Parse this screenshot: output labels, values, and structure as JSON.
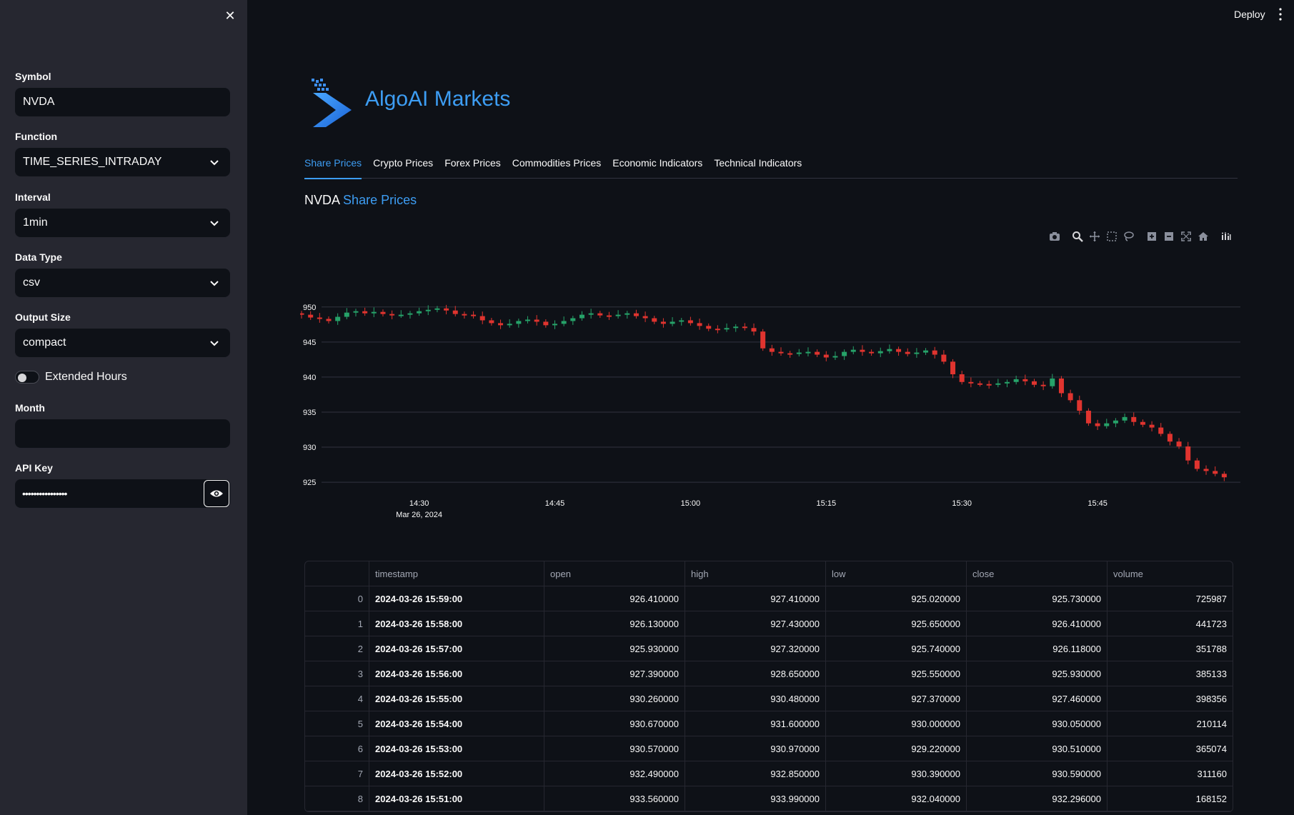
{
  "sidebar": {
    "symbol": {
      "label": "Symbol",
      "value": "NVDA"
    },
    "function": {
      "label": "Function",
      "value": "TIME_SERIES_INTRADAY"
    },
    "interval": {
      "label": "Interval",
      "value": "1min"
    },
    "data_type": {
      "label": "Data Type",
      "value": "csv"
    },
    "output_size": {
      "label": "Output Size",
      "value": "compact"
    },
    "extended_hours": {
      "label": "Extended Hours",
      "checked": false
    },
    "month": {
      "label": "Month",
      "value": ""
    },
    "api_key": {
      "label": "API Key",
      "masked": "••••••••••••••••"
    }
  },
  "header": {
    "deploy_label": "Deploy",
    "brand": "AlgoAI Markets"
  },
  "tabs": [
    {
      "label": "Share Prices",
      "active": true
    },
    {
      "label": "Crypto Prices"
    },
    {
      "label": "Forex Prices"
    },
    {
      "label": "Commodities Prices"
    },
    {
      "label": "Economic Indicators"
    },
    {
      "label": "Technical Indicators"
    }
  ],
  "section": {
    "symbol": "NVDA",
    "title": "Share Prices"
  },
  "colors": {
    "accent": "#3d9df3",
    "up": "#26a269",
    "down": "#e0342f"
  },
  "chart_data": {
    "type": "candlestick",
    "y_ticks": [
      "950",
      "945",
      "940",
      "935",
      "930",
      "925"
    ],
    "ylim": [
      924.5,
      951
    ],
    "x_ticks": [
      "14:30",
      "14:45",
      "15:00",
      "15:15",
      "15:30",
      "15:45"
    ],
    "x_date_label": "Mar 26, 2024",
    "x_start": "14:20",
    "x_end": "16:00",
    "closes": [
      949.2,
      949.0,
      949.1,
      948.9,
      948.5,
      948.3,
      948.0,
      948.6,
      949.2,
      949.4,
      949.1,
      949.3,
      949.0,
      948.8,
      948.9,
      949.1,
      949.4,
      949.6,
      949.8,
      949.5,
      949.0,
      948.9,
      948.7,
      948.1,
      947.7,
      947.4,
      947.6,
      948.0,
      948.2,
      947.9,
      947.4,
      947.6,
      948.0,
      948.4,
      948.9,
      949.1,
      948.8,
      948.7,
      948.9,
      949.1,
      948.7,
      948.4,
      947.9,
      947.6,
      947.9,
      948.1,
      947.7,
      947.3,
      946.9,
      946.8,
      947.0,
      947.2,
      947.0,
      946.5,
      944.1,
      943.6,
      943.4,
      943.3,
      943.5,
      943.6,
      943.2,
      942.8,
      943.0,
      943.6,
      943.9,
      943.6,
      943.4,
      943.7,
      944.0,
      943.6,
      943.3,
      943.5,
      943.8,
      943.2,
      942.2,
      940.4,
      939.3,
      939.1,
      939.0,
      938.9,
      939.1,
      939.3,
      939.7,
      939.4,
      938.9,
      938.7,
      939.8,
      937.7,
      936.7,
      935.2,
      933.4,
      933.0,
      933.4,
      933.8,
      934.3,
      933.6,
      933.2,
      932.8,
      931.9,
      930.8,
      930.1,
      928.1,
      926.9,
      926.6,
      926.2,
      925.7
    ],
    "opens": [
      949.0,
      949.2,
      949.0,
      949.1,
      948.9,
      948.5,
      948.3,
      948.0,
      948.6,
      949.2,
      949.4,
      949.1,
      949.3,
      949.0,
      948.8,
      948.9,
      949.1,
      949.4,
      949.6,
      949.8,
      949.5,
      949.0,
      948.9,
      948.7,
      948.1,
      947.7,
      947.4,
      947.6,
      948.0,
      948.2,
      947.9,
      947.4,
      947.6,
      948.0,
      948.4,
      948.9,
      949.1,
      948.8,
      948.7,
      948.9,
      949.1,
      948.7,
      948.4,
      947.9,
      947.6,
      947.9,
      948.1,
      947.7,
      947.3,
      946.9,
      946.8,
      947.0,
      947.2,
      947.0,
      946.5,
      944.1,
      943.6,
      943.4,
      943.3,
      943.5,
      943.6,
      943.2,
      942.8,
      943.0,
      943.6,
      943.9,
      943.6,
      943.4,
      943.7,
      944.0,
      943.6,
      943.3,
      943.5,
      943.8,
      943.2,
      942.2,
      940.4,
      939.3,
      939.1,
      939.0,
      938.9,
      939.1,
      939.3,
      939.7,
      939.4,
      938.9,
      938.7,
      939.8,
      937.7,
      936.7,
      935.2,
      933.4,
      933.0,
      933.4,
      933.8,
      934.3,
      933.6,
      933.2,
      932.8,
      931.9,
      930.8,
      930.1,
      928.1,
      926.9,
      926.6,
      926.2
    ]
  },
  "table": {
    "columns": [
      "timestamp",
      "open",
      "high",
      "low",
      "close",
      "volume"
    ],
    "rows": [
      [
        "0",
        "2024-03-26 15:59:00",
        "926.410000",
        "927.410000",
        "925.020000",
        "925.730000",
        "725987"
      ],
      [
        "1",
        "2024-03-26 15:58:00",
        "926.130000",
        "927.430000",
        "925.650000",
        "926.410000",
        "441723"
      ],
      [
        "2",
        "2024-03-26 15:57:00",
        "925.930000",
        "927.320000",
        "925.740000",
        "926.118000",
        "351788"
      ],
      [
        "3",
        "2024-03-26 15:56:00",
        "927.390000",
        "928.650000",
        "925.550000",
        "925.930000",
        "385133"
      ],
      [
        "4",
        "2024-03-26 15:55:00",
        "930.260000",
        "930.480000",
        "927.370000",
        "927.460000",
        "398356"
      ],
      [
        "5",
        "2024-03-26 15:54:00",
        "930.670000",
        "931.600000",
        "930.000000",
        "930.050000",
        "210114"
      ],
      [
        "6",
        "2024-03-26 15:53:00",
        "930.570000",
        "930.970000",
        "929.220000",
        "930.510000",
        "365074"
      ],
      [
        "7",
        "2024-03-26 15:52:00",
        "932.490000",
        "932.850000",
        "930.390000",
        "930.590000",
        "311160"
      ],
      [
        "8",
        "2024-03-26 15:51:00",
        "933.560000",
        "933.990000",
        "932.040000",
        "932.296000",
        "168152"
      ]
    ]
  }
}
